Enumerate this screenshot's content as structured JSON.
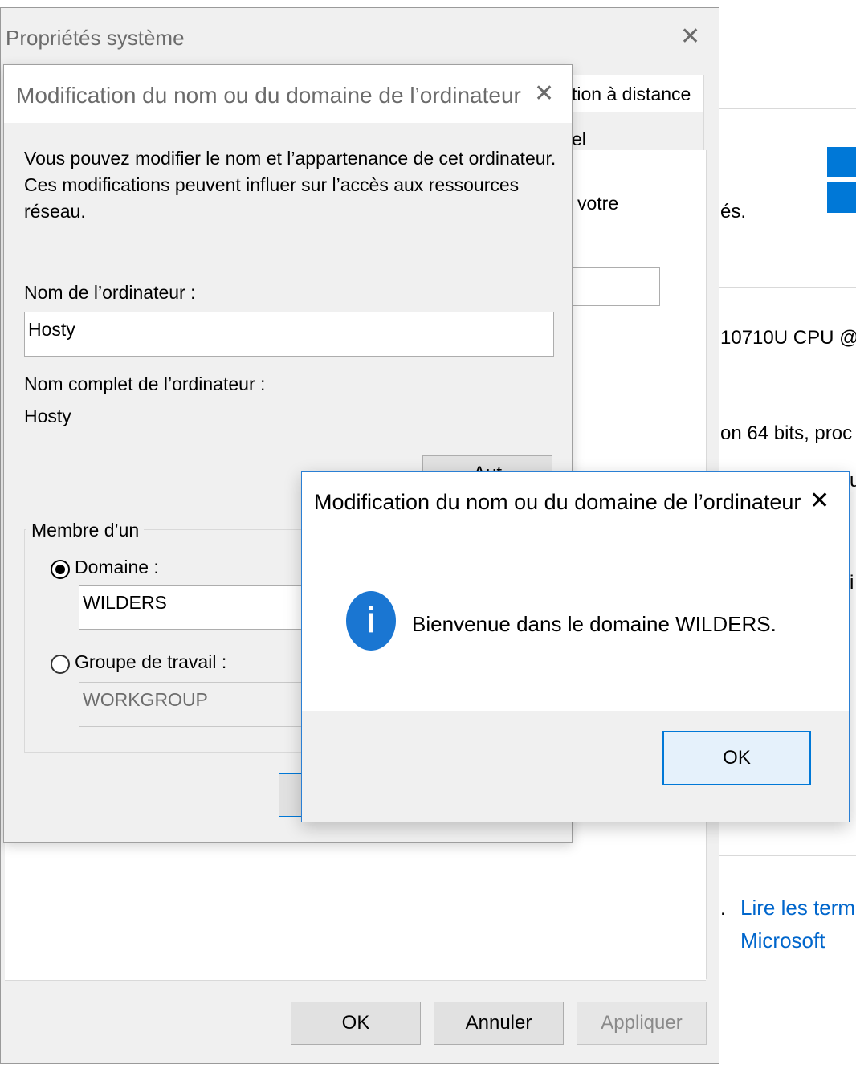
{
  "background_window": {
    "text_copyright_fragment": "és.",
    "processor_fragment": "10710U CPU @",
    "system_type_fragment": "on 64 bits, proc",
    "edge_fragment_1": "u",
    "edge_fragment_2": "i",
    "license_separator": ".",
    "license_link_line1": "Lire les terme",
    "license_link_line2": "Microsoft",
    "logo_icon": "windows-logo"
  },
  "system_properties": {
    "title": "Propriétés système",
    "close_glyph": "✕",
    "tab_remote": "tion à distance",
    "tab_partial": "el",
    "description_fragment": "votre",
    "buttons": {
      "ok": "OK",
      "cancel": "Annuler",
      "apply": "Appliquer"
    }
  },
  "rename_dialog": {
    "title": "Modification du nom ou du domaine de l’ordinateur",
    "close_glyph": "✕",
    "intro": "Vous pouvez modifier le nom et l’appartenance de cet ordinateur. Ces modifications peuvent influer sur l’accès aux ressources réseau.",
    "computer_name_label": "Nom de l’ordinateur :",
    "computer_name_value": "Hosty",
    "full_name_label": "Nom complet de l’ordinateur :",
    "full_name_value": "Hosty",
    "more_button_partial": "Aut",
    "member_of_label": "Membre d’un",
    "domain_label": "Domaine :",
    "domain_value": "WILDERS",
    "domain_selected": true,
    "workgroup_label": "Groupe de travail :",
    "workgroup_value": "WORKGROUP",
    "workgroup_selected": false
  },
  "message_box": {
    "title": "Modification du nom ou du domaine de l’ordinateur",
    "close_glyph": "✕",
    "icon": "info-icon",
    "icon_glyph": "i",
    "message": "Bienvenue dans le domaine WILDERS.",
    "ok_label": "OK"
  },
  "colors": {
    "accent": "#0078d7",
    "link": "#0066cc",
    "window_bg": "#f0f0f0"
  }
}
